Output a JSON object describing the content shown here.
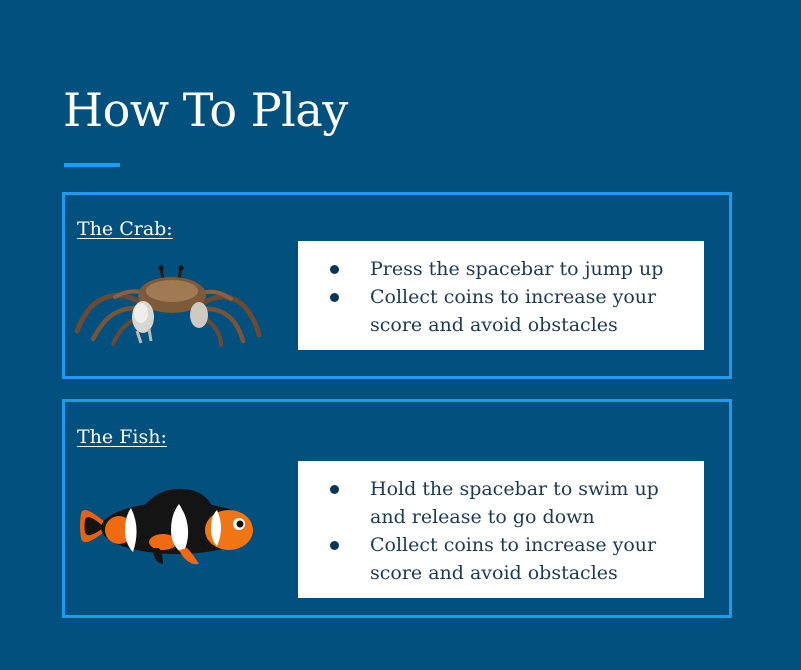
{
  "page": {
    "title": "How To Play"
  },
  "colors": {
    "background": "#02507e",
    "accent": "#1b9cf0",
    "panel": "#ffffff",
    "text_dark": "#1d3a55"
  },
  "sections": [
    {
      "label": "The Crab:",
      "image": "crab-image",
      "instructions": [
        "Press the spacebar to jump up",
        "Collect coins to increase your score and avoid obstacles"
      ]
    },
    {
      "label": "The Fish:",
      "image": "clownfish-image",
      "instructions": [
        "Hold the spacebar to swim up and release to go down",
        "Collect coins to increase your score and avoid obstacles"
      ]
    }
  ]
}
